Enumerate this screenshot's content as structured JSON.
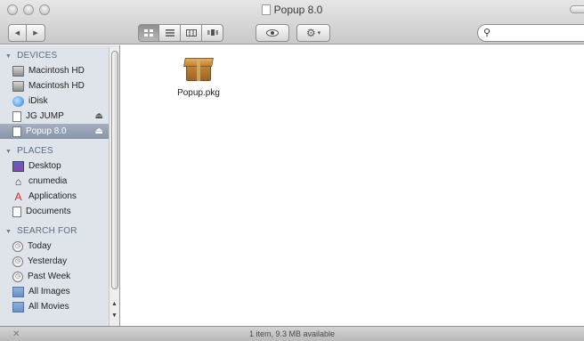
{
  "window": {
    "title": "Popup 8.0"
  },
  "toolbar": {
    "back_icon": "◀",
    "forward_icon": "▶",
    "view_icons": [
      "icon-view",
      "list-view",
      "column-view",
      "coverflow-view"
    ],
    "quicklook_icon": "eye-icon",
    "action_icon": "gear-icon",
    "search": {
      "value": "",
      "placeholder": ""
    }
  },
  "sidebar": {
    "sections": [
      {
        "title": "DEVICES",
        "items": [
          {
            "label": "Macintosh HD",
            "icon": "disk-icon",
            "eject": false,
            "selected": false
          },
          {
            "label": "Macintosh HD",
            "icon": "disk-icon",
            "eject": false,
            "selected": false
          },
          {
            "label": "iDisk",
            "icon": "idisk-icon",
            "eject": false,
            "selected": false
          },
          {
            "label": "JG JUMP",
            "icon": "drive-icon",
            "eject": true,
            "selected": false
          },
          {
            "label": "Popup 8.0",
            "icon": "drive-icon",
            "eject": true,
            "selected": true
          }
        ]
      },
      {
        "title": "PLACES",
        "items": [
          {
            "label": "Desktop",
            "icon": "desktop-icon"
          },
          {
            "label": "cnumedia",
            "icon": "home-icon"
          },
          {
            "label": "Applications",
            "icon": "applications-icon"
          },
          {
            "label": "Documents",
            "icon": "documents-icon"
          }
        ]
      },
      {
        "title": "SEARCH FOR",
        "items": [
          {
            "label": "Today",
            "icon": "clock-icon"
          },
          {
            "label": "Yesterday",
            "icon": "clock-icon"
          },
          {
            "label": "Past Week",
            "icon": "clock-icon"
          },
          {
            "label": "All Images",
            "icon": "smart-folder-icon"
          },
          {
            "label": "All Movies",
            "icon": "smart-folder-icon"
          }
        ]
      }
    ]
  },
  "content": {
    "files": [
      {
        "name": "Popup.pkg",
        "icon": "package-icon"
      }
    ]
  },
  "status": {
    "text": "1 item, 9.3 MB available"
  }
}
